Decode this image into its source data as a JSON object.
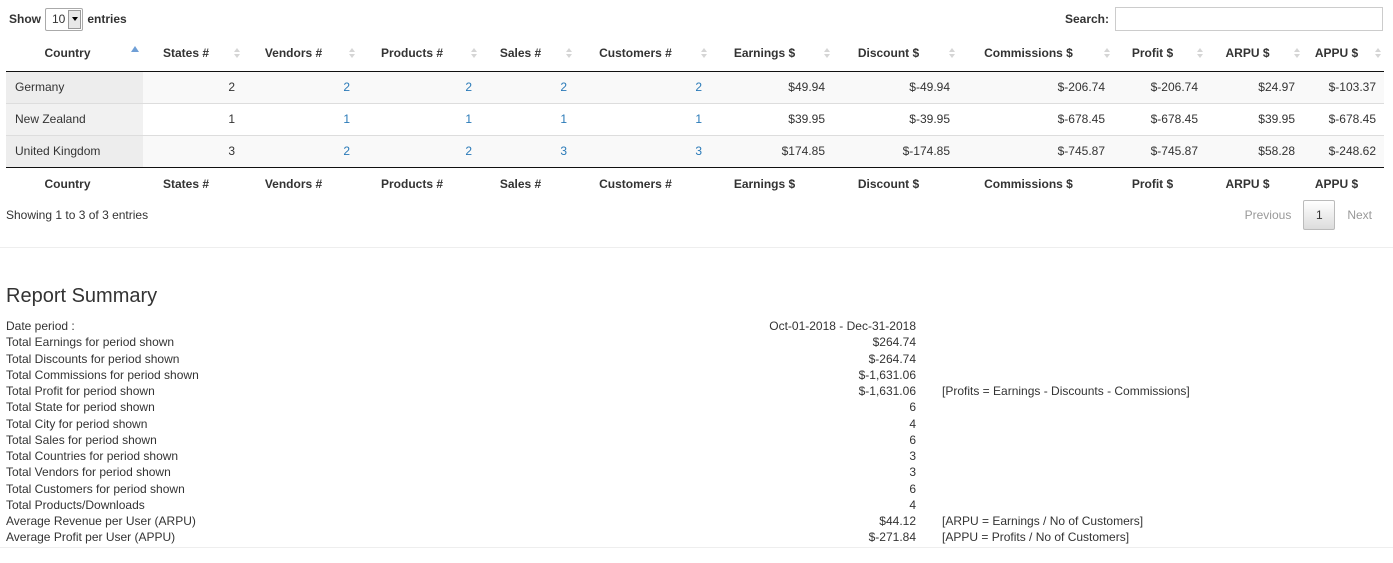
{
  "length": {
    "show_label": "Show",
    "selected": "10",
    "entries_label": "entries"
  },
  "search": {
    "label": "Search:",
    "value": ""
  },
  "table": {
    "columns": [
      "Country",
      "States #",
      "Vendors #",
      "Products #",
      "Sales #",
      "Customers #",
      "Earnings $",
      "Discount $",
      "Commissions $",
      "Profit $",
      "ARPU $",
      "APPU $"
    ],
    "rows": [
      [
        "Germany",
        "2",
        "2",
        "2",
        "2",
        "2",
        "$49.94",
        "$-49.94",
        "$-206.74",
        "$-206.74",
        "$24.97",
        "$-103.37"
      ],
      [
        "New Zealand",
        "1",
        "1",
        "1",
        "1",
        "1",
        "$39.95",
        "$-39.95",
        "$-678.45",
        "$-678.45",
        "$39.95",
        "$-678.45"
      ],
      [
        "United Kingdom",
        "3",
        "2",
        "2",
        "3",
        "3",
        "$174.85",
        "$-174.85",
        "$-745.87",
        "$-745.87",
        "$58.28",
        "$-248.62"
      ]
    ]
  },
  "info": "Showing 1 to 3 of 3 entries",
  "pagination": {
    "previous": "Previous",
    "current": "1",
    "next": "Next"
  },
  "summary": {
    "title": "Report Summary",
    "rows": [
      {
        "label": "Date period :",
        "value": "Oct-01-2018 - Dec-31-2018",
        "note": ""
      },
      {
        "label": "Total Earnings for period shown",
        "value": "$264.74",
        "note": ""
      },
      {
        "label": "Total Discounts for period shown",
        "value": "$-264.74",
        "note": ""
      },
      {
        "label": "Total Commissions for period shown",
        "value": "$-1,631.06",
        "note": ""
      },
      {
        "label": "Total Profit for period shown",
        "value": "$-1,631.06",
        "note": "[Profits = Earnings - Discounts - Commissions]"
      },
      {
        "label": "Total State for period shown",
        "value": "6",
        "note": ""
      },
      {
        "label": "Total City for period shown",
        "value": "4",
        "note": ""
      },
      {
        "label": "Total Sales for period shown",
        "value": "6",
        "note": ""
      },
      {
        "label": "Total Countries for period shown",
        "value": "3",
        "note": ""
      },
      {
        "label": "Total Vendors for period shown",
        "value": "3",
        "note": ""
      },
      {
        "label": "Total Customers for period shown",
        "value": "6",
        "note": ""
      },
      {
        "label": "Total Products/Downloads",
        "value": "4",
        "note": ""
      },
      {
        "label": "Average Revenue per User (ARPU)",
        "value": "$44.12",
        "note": "[ARPU = Earnings / No of Customers]"
      },
      {
        "label": "Average Profit per User (APPU)",
        "value": "$-271.84",
        "note": "[APPU = Profits / No of Customers]"
      }
    ]
  }
}
